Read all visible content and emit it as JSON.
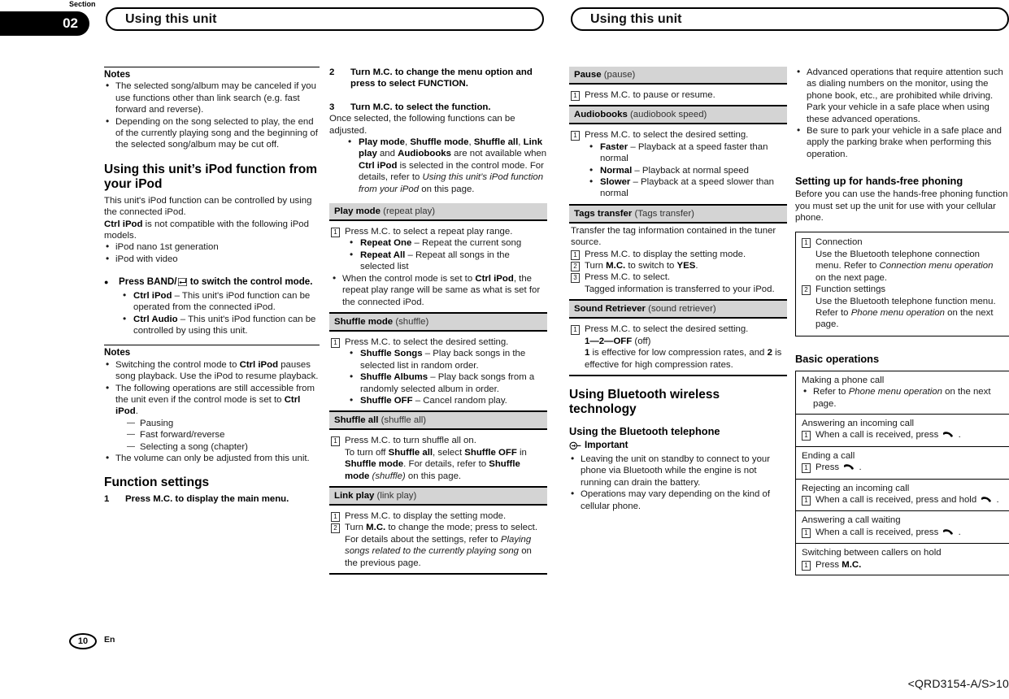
{
  "header": {
    "section_label": "Section",
    "section_number": "02",
    "title_left": "Using this unit",
    "title_right": "Using this unit"
  },
  "footer": {
    "page_number": "10",
    "language": "En",
    "part_number": "<QRD3154-A/S>10"
  },
  "col1": {
    "notes1_head": "Notes",
    "notes1_items": [
      "The selected song/album may be canceled if you use functions other than link search (e.g. fast forward and reverse).",
      "Depending on the song selected to play, the end of the currently playing song and the beginning of the selected song/album may be cut off."
    ],
    "heading_ipod": "Using this unit’s iPod function from your iPod",
    "ipod_intro1": "This unit's iPod function can be controlled by using the connected iPod.",
    "ipod_intro2_b": "Ctrl iPod",
    "ipod_intro2_rest": " is not compatible with the following iPod models.",
    "ipod_models": [
      "iPod nano 1st generation",
      "iPod with video"
    ],
    "band_label_a": "Press BAND/",
    "band_label_b": " to switch the control mode.",
    "band_items": [
      {
        "term": "Ctrl iPod",
        "desc": " – This unit's iPod function can be operated from the connected iPod."
      },
      {
        "term": "Ctrl Audio",
        "desc": " – This unit's iPod function can be controlled by using this unit."
      }
    ],
    "notes2_head": "Notes",
    "note2_1a": "Switching the control mode to ",
    "note2_1b": "Ctrl iPod",
    "note2_1c": " pauses song playback. Use the iPod to resume playback.",
    "note2_2a": "The following operations are still accessible from the unit even if the control mode is set to ",
    "note2_2b": "Ctrl iPod",
    "note2_2c": ".",
    "note2_sub": [
      "Pausing",
      "Fast forward/reverse",
      "Selecting a song (chapter)"
    ],
    "note2_3": "The volume can only be adjusted from this unit.",
    "heading_function": "Function settings",
    "step1_num": "1",
    "step1_text": "Press M.C. to display the main menu."
  },
  "col2": {
    "step2_num": "2",
    "step2_text": "Turn M.C. to change the menu option and press to select FUNCTION.",
    "step3_num": "3",
    "step3_text": "Turn M.C. to select the function.",
    "step3_sub": "Once selected, the following functions can be adjusted.",
    "bullet_avail": {
      "b1": "Play mode",
      "t1": ", ",
      "b2": "Shuffle mode",
      "t2": ", ",
      "b3": "Shuffle all",
      "t3": ", ",
      "b4": "Link play",
      "t4": " and ",
      "b5": "Audiobooks",
      "t5": " are not available when ",
      "b6": "Ctrl iPod",
      "t6": " is selected in the control mode. For details, refer to ",
      "i7": "Using this unit’s iPod function from your iPod",
      "t7": " on this page."
    },
    "playmode": {
      "title": "Play mode",
      "paren": " (repeat play)",
      "step1": "Press M.C. to select a repeat play range.",
      "opts": [
        {
          "term": "Repeat One",
          "desc": " – Repeat the current song"
        },
        {
          "term": "Repeat All",
          "desc": " – Repeat all songs in the selected list"
        }
      ],
      "note_a": "When the control mode is set to ",
      "note_b": "Ctrl iPod",
      "note_c": ", the repeat play range will be same as what is set for the connected iPod."
    },
    "shufflemode": {
      "title": "Shuffle mode",
      "paren": " (shuffle)",
      "step1": "Press M.C. to select the desired setting.",
      "opts": [
        {
          "term": "Shuffle Songs",
          "desc": " – Play back songs in the selected list in random order."
        },
        {
          "term": "Shuffle Albums",
          "desc": " – Play back songs from a randomly selected album in order."
        },
        {
          "term": "Shuffle OFF",
          "desc": " – Cancel random play."
        }
      ]
    },
    "shuffleall": {
      "title": "Shuffle all",
      "paren": " (shuffle all)",
      "step1": "Press M.C. to turn shuffle all on.",
      "line2_a": "To turn off ",
      "line2_b": "Shuffle all",
      "line2_c": ", select ",
      "line2_d": "Shuffle OFF",
      "line2_e": " in ",
      "line2_f": "Shuffle mode",
      "line2_g": ". For details, refer to ",
      "line2_h": "Shuffle mode",
      "line2_i": " (shuffle)",
      "line2_j": " on this page."
    },
    "linkplay": {
      "title": "Link play",
      "paren": " (link play)",
      "step1": "Press M.C. to display the setting mode.",
      "step2_a": "Turn ",
      "step2_b": "M.C.",
      "step2_c": " to change the mode; press to select. For details about the settings, refer to ",
      "step2_i": "Playing songs related to the currently playing song",
      "step2_d": " on the previous page."
    }
  },
  "col3": {
    "pause": {
      "title": "Pause",
      "paren": " (pause)",
      "step1": "Press M.C. to pause or resume."
    },
    "audiobooks": {
      "title": "Audiobooks",
      "paren": " (audiobook speed)",
      "step1": "Press M.C. to select the desired setting.",
      "opts": [
        {
          "term": "Faster",
          "desc": " – Playback at a speed faster than normal"
        },
        {
          "term": "Normal",
          "desc": " – Playback at normal speed"
        },
        {
          "term": "Slower",
          "desc": " – Playback at a speed slower than normal"
        }
      ]
    },
    "tags": {
      "title": "Tags transfer",
      "paren": " (Tags transfer)",
      "intro": "Transfer the tag information contained in the tuner source.",
      "step1": "Press M.C. to display the setting mode.",
      "step2_a": "Turn ",
      "step2_b": "M.C.",
      "step2_c": " to switch to ",
      "step2_d": "YES",
      "step2_e": ".",
      "step3": "Press M.C. to select.",
      "step3_sub": "Tagged information is transferred to your iPod."
    },
    "sound": {
      "title": "Sound Retriever",
      "paren": " (sound retriever)",
      "step1": "Press M.C. to select the desired setting.",
      "values": "1—2—OFF",
      "values_paren": " (off)",
      "desc_a": "1",
      "desc_b": " is effective for low compression rates, and ",
      "desc_c": "2",
      "desc_d": " is effective for high compression rates."
    },
    "bt_heading": "Using Bluetooth wireless technology",
    "bt_sub": "Using the Bluetooth telephone",
    "important_label": "Important",
    "important_items": [
      "Leaving the unit on standby to connect to your phone via Bluetooth while the engine is not running can drain the battery.",
      "Operations may vary depending on the kind of cellular phone."
    ]
  },
  "col4": {
    "warn_items": [
      "Advanced operations that require attention such as dialing numbers on the monitor, using the phone book, etc., are prohibited while driving. Park your vehicle in a safe place when using these advanced operations.",
      "Be sure to park your vehicle in a safe place and apply the parking brake when performing this operation."
    ],
    "setup_heading": "Setting up for hands-free phoning",
    "setup_intro": "Before you can use the hands-free phoning function you must set up the unit for use with your cellular phone.",
    "setup_box": {
      "item1_title": "Connection",
      "item1_a": "Use the Bluetooth telephone connection menu. Refer to ",
      "item1_i": "Connection menu operation",
      "item1_b": " on the next page.",
      "item2_title": "Function settings",
      "item2_a": "Use the Bluetooth telephone function menu. Refer to ",
      "item2_i": "Phone menu operation",
      "item2_b": " on the next page."
    },
    "basic_heading": "Basic operations",
    "basic_rows": [
      {
        "title": "Making a phone call",
        "bullet": true,
        "line_a": "Refer to ",
        "line_i": "Phone menu operation",
        "line_b": " on the next page."
      },
      {
        "title": "Answering an incoming call",
        "bullet": false,
        "line_a": "When a call is received, press ",
        "line_b": " .",
        "phone": true
      },
      {
        "title": "Ending a call",
        "bullet": false,
        "line_a": "Press ",
        "line_b": " .",
        "phone": true
      },
      {
        "title": "Rejecting an incoming call",
        "bullet": false,
        "line_a": "When a call is received, press and hold ",
        "line_b": " .",
        "phone": true
      },
      {
        "title": "Answering a call waiting",
        "bullet": false,
        "line_a": "When a call is received, press ",
        "line_b": " .",
        "phone": true
      },
      {
        "title": "Switching between callers on hold",
        "bullet": false,
        "line_a": "Press ",
        "line_b": "M.C.",
        "phone": false
      }
    ]
  },
  "icons": {
    "phone": "phone-handset-icon",
    "return": "return-arrow-icon",
    "important": "important-icon"
  },
  "colors": {
    "gray_bar": "#d4d4d4",
    "rule": "#000000"
  }
}
